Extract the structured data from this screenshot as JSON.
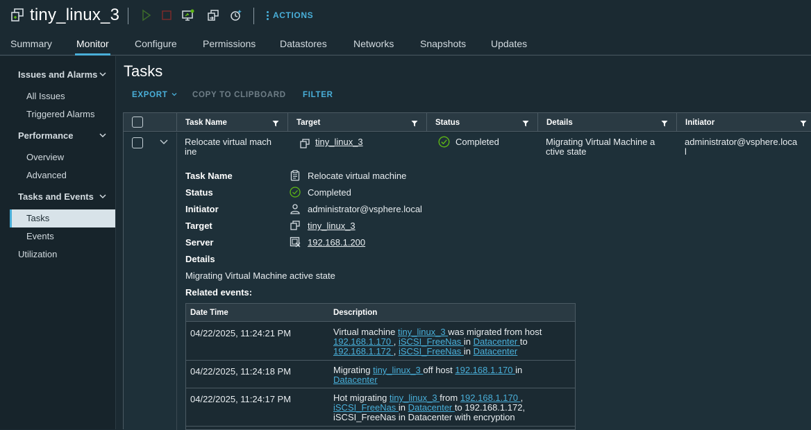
{
  "header": {
    "vm_name": "tiny_linux_3",
    "actions_label": "ACTIONS"
  },
  "tabs": [
    {
      "label": "Summary"
    },
    {
      "label": "Monitor"
    },
    {
      "label": "Configure"
    },
    {
      "label": "Permissions"
    },
    {
      "label": "Datastores"
    },
    {
      "label": "Networks"
    },
    {
      "label": "Snapshots"
    },
    {
      "label": "Updates"
    }
  ],
  "sidebar": {
    "issues_group": "Issues and Alarms",
    "all_issues": "All Issues",
    "triggered_alarms": "Triggered Alarms",
    "performance_group": "Performance",
    "overview": "Overview",
    "advanced": "Advanced",
    "tasks_events_group": "Tasks and Events",
    "tasks": "Tasks",
    "events": "Events",
    "utilization": "Utilization"
  },
  "main": {
    "title": "Tasks",
    "export_label": "EXPORT",
    "copy_label": "COPY TO CLIPBOARD",
    "filter_label": "FILTER"
  },
  "grid": {
    "columns": {
      "task_name": "Task Name",
      "target": "Target",
      "status": "Status",
      "details": "Details",
      "initiator": "Initiator"
    },
    "row": {
      "task_name_l1": "Relocate virtual mach",
      "task_name_l2": "ine",
      "target": "tiny_linux_3",
      "status": "Completed",
      "details_l1": "Migrating Virtual Machine a",
      "details_l2": "ctive state",
      "initiator_l1": "administrator@vsphere.loca",
      "initiator_l2": "l"
    }
  },
  "detail": {
    "task_name_label": "Task Name",
    "task_name_value": "Relocate virtual machine",
    "status_label": "Status",
    "status_value": "Completed",
    "initiator_label": "Initiator",
    "initiator_value": "administrator@vsphere.local",
    "target_label": "Target",
    "target_value": "tiny_linux_3",
    "server_label": "Server",
    "server_value": "192.168.1.200",
    "details_label": "Details",
    "details_value": "Migrating Virtual Machine active state",
    "related_label": "Related events:"
  },
  "events": {
    "col_datetime": "Date Time",
    "col_description": "Description",
    "e1": {
      "datetime": "04/22/2025, 11:24:21 PM",
      "t1": "Virtual machine ",
      "l1": "tiny_linux_3 ",
      "t2": "was migrated from host",
      "l2": "192.168.1.170 ",
      "t3": ", ",
      "l3": "iSCSI_FreeNas ",
      "t4": "in ",
      "l4": "Datacenter ",
      "t5": "to",
      "l5": "192.168.1.172 ",
      "t6": ", ",
      "l6": "iSCSI_FreeNas ",
      "t7": "in ",
      "l7": "Datacenter"
    },
    "e2": {
      "datetime": "04/22/2025, 11:24:18 PM",
      "t1": "Migrating ",
      "l1": "tiny_linux_3 ",
      "t2": "off host ",
      "l2": "192.168.1.170 ",
      "t3": "in",
      "l3": "Datacenter"
    },
    "e3": {
      "datetime": "04/22/2025, 11:24:17 PM",
      "t1": "Hot migrating ",
      "l1": "tiny_linux_3 ",
      "t2": "from ",
      "l2": "192.168.1.170 ",
      "t3": ",",
      "l3": "iSCSI_FreeNas ",
      "t4": "in ",
      "l4": "Datacenter ",
      "t5": "to 192.168.1.172,",
      "t6": "iSCSI_FreeNas in Datacenter with encryption"
    }
  },
  "colors": {
    "accent": "#49afd9",
    "success": "#5eb715",
    "background": "#1b2a32"
  }
}
